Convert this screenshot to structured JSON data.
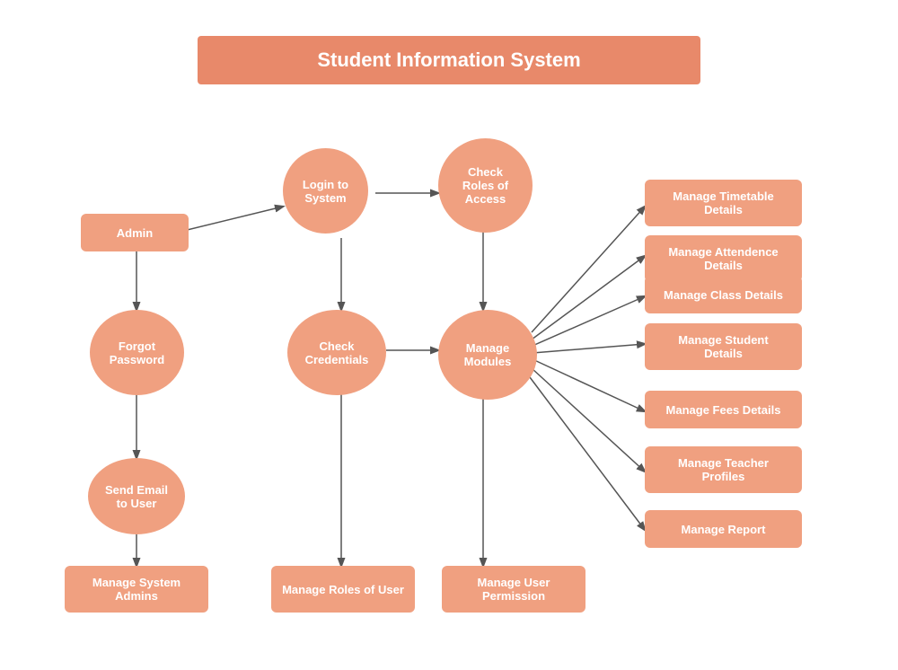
{
  "title": "Student Information System",
  "nodes": {
    "title": "Student Information System",
    "admin": "Admin",
    "login": "Login to\nSystem",
    "check_roles": "Check\nRoles of\nAccess",
    "forgot": "Forgot\nPassword",
    "check_creds": "Check\nCredentials",
    "manage_modules": "Manage\nModules",
    "send_email": "Send Email\nto User",
    "manage_sys_admins": "Manage System\nAdmins",
    "manage_roles": "Manage Roles of User",
    "manage_user_perm": "Manage User\nPermission",
    "timetable": "Manage Timetable\nDetails",
    "attendance": "Manage Attendence\nDetails",
    "class": "Manage Class Details",
    "student": "Manage Student\nDetails",
    "fees": "Manage Fees Details",
    "teacher": "Manage Teacher\nProfiles",
    "report": "Manage Report"
  }
}
